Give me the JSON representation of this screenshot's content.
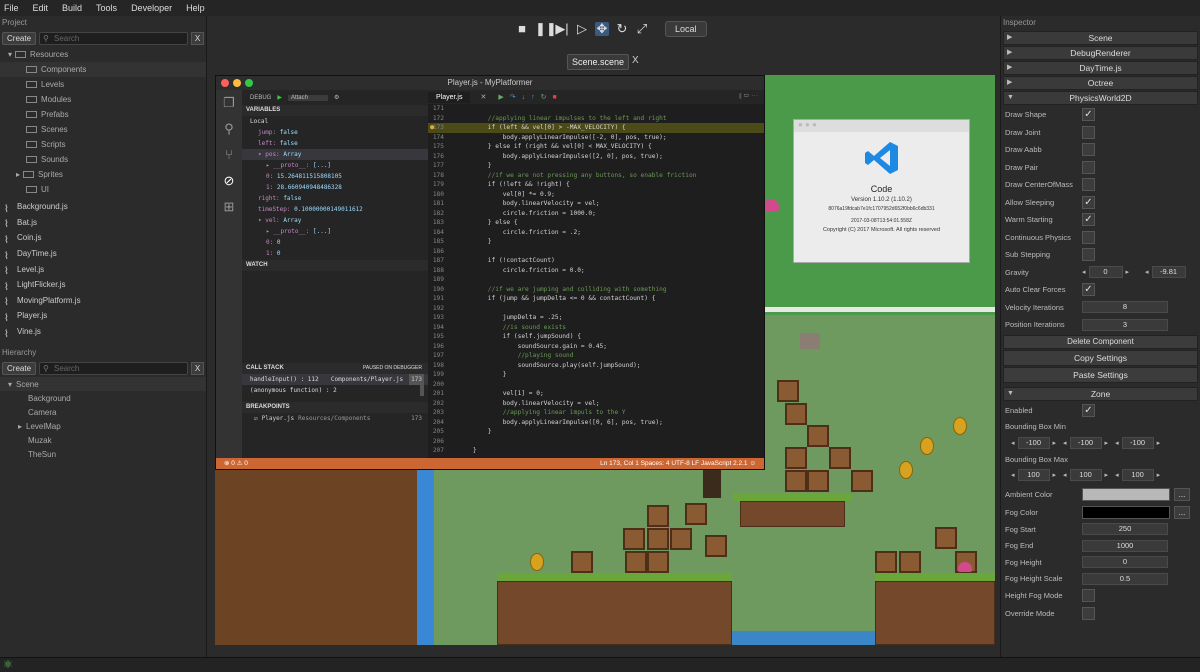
{
  "menu": [
    "File",
    "Edit",
    "Build",
    "Tools",
    "Developer",
    "Help"
  ],
  "toolbar": {
    "local_label": "Local"
  },
  "project": {
    "title": "Project",
    "create": "Create",
    "search_placeholder": "Search",
    "close": "X",
    "folders": [
      "Resources",
      "Components",
      "Levels",
      "Modules",
      "Prefabs",
      "Scenes",
      "Scripts",
      "Sounds",
      "Sprites",
      "UI"
    ],
    "scripts": [
      "Background.js",
      "Bat.js",
      "Coin.js",
      "DayTime.js",
      "Level.js",
      "LightFlicker.js",
      "MovingPlatform.js",
      "Player.js",
      "Vine.js"
    ]
  },
  "hierarchy": {
    "title": "Hierarchy",
    "create": "Create",
    "search_placeholder": "Search",
    "close": "X",
    "items": [
      "Scene",
      "Background",
      "Camera",
      "LevelMap",
      "Muzak",
      "TheSun"
    ]
  },
  "scene_tab": {
    "label": "Scene.scene",
    "close": "X"
  },
  "vscode": {
    "title": "Player.js - MyPlatformer",
    "debug_label": "DEBUG",
    "attach": "Attach",
    "variables": "VARIABLES",
    "local": "Local",
    "vars": [
      {
        "k": "jump:",
        "v": "false",
        "ind": 0
      },
      {
        "k": "left:",
        "v": "false",
        "ind": 0
      },
      {
        "k": "▾ pos:",
        "v": "Array",
        "ind": 0
      },
      {
        "k": "▸ __proto__:",
        "v": "[...]",
        "ind": 1
      },
      {
        "k": "0:",
        "v": "15.264811515808105",
        "ind": 1
      },
      {
        "k": "1:",
        "v": "28.660940948486328",
        "ind": 1
      },
      {
        "k": "right:",
        "v": "false",
        "ind": 0
      },
      {
        "k": "timeStep:",
        "v": "0.10000000149011612",
        "ind": 0
      },
      {
        "k": "▾ vel:",
        "v": "Array",
        "ind": 0
      },
      {
        "k": "▸ __proto__:",
        "v": "[...]",
        "ind": 1
      },
      {
        "k": "0:",
        "v": "0",
        "ind": 1
      },
      {
        "k": "1:",
        "v": "0",
        "ind": 1
      }
    ],
    "watch": "WATCH",
    "callstack": "CALL STACK",
    "paused": "PAUSED ON DEBUGGER",
    "stack": [
      {
        "fn": "handleInput() : 112",
        "file": "Components/Player.js",
        "ln": "173"
      },
      {
        "fn": "(anonymous function) : 2",
        "file": "",
        "ln": ""
      }
    ],
    "breakpoints": "BREAKPOINTS",
    "bp_file": "Player.js",
    "bp_path": "Resources/Components",
    "bp_line": "173",
    "tab": "Player.js",
    "code": [
      {
        "n": "171",
        "t": ""
      },
      {
        "n": "172",
        "t": "        //applying linear impulses to the left and right"
      },
      {
        "n": "173",
        "t": "        if (left && vel[0] > -MAX_VELOCITY) {"
      },
      {
        "n": "174",
        "t": "            body.applyLinearImpulse([-2, 0], pos, true);"
      },
      {
        "n": "175",
        "t": "        } else if (right && vel[0] < MAX_VELOCITY) {"
      },
      {
        "n": "176",
        "t": "            body.applyLinearImpulse([2, 0], pos, true);"
      },
      {
        "n": "177",
        "t": "        }"
      },
      {
        "n": "178",
        "t": "        //if we are not pressing any buttons, so enable friction"
      },
      {
        "n": "179",
        "t": "        if (!left && !right) {"
      },
      {
        "n": "180",
        "t": "            vel[0] *= 0.9;"
      },
      {
        "n": "181",
        "t": "            body.linearVelocity = vel;"
      },
      {
        "n": "182",
        "t": "            circle.friction = 1000.0;"
      },
      {
        "n": "183",
        "t": "        } else {"
      },
      {
        "n": "184",
        "t": "            circle.friction = .2;"
      },
      {
        "n": "185",
        "t": "        }"
      },
      {
        "n": "186",
        "t": ""
      },
      {
        "n": "187",
        "t": "        if (!contactCount)"
      },
      {
        "n": "188",
        "t": "            circle.friction = 0.0;"
      },
      {
        "n": "189",
        "t": ""
      },
      {
        "n": "190",
        "t": "        //if we are jumping and colliding with something"
      },
      {
        "n": "191",
        "t": "        if (jump && jumpDelta <= 0 && contactCount) {"
      },
      {
        "n": "192",
        "t": ""
      },
      {
        "n": "193",
        "t": "            jumpDelta = .25;"
      },
      {
        "n": "194",
        "t": "            //is sound exists"
      },
      {
        "n": "195",
        "t": "            if (self.jumpSound) {"
      },
      {
        "n": "196",
        "t": "                soundSource.gain = 0.45;"
      },
      {
        "n": "197",
        "t": "                //playing sound"
      },
      {
        "n": "198",
        "t": "                soundSource.play(self.jumpSound);"
      },
      {
        "n": "199",
        "t": "            }"
      },
      {
        "n": "200",
        "t": ""
      },
      {
        "n": "201",
        "t": "            vel[1] = 0;"
      },
      {
        "n": "202",
        "t": "            body.linearVelocity = vel;"
      },
      {
        "n": "203",
        "t": "            //applying linear impuls to the Y"
      },
      {
        "n": "204",
        "t": "            body.applyLinearImpulse([0, 6], pos, true);"
      },
      {
        "n": "205",
        "t": "        }"
      },
      {
        "n": "206",
        "t": ""
      },
      {
        "n": "207",
        "t": "    }"
      }
    ],
    "status_left": "⊗ 0  ⚠ 0",
    "status_right": "Ln 173, Col 1    Spaces: 4    UTF-8    LF    JavaScript    2.2.1    ☺"
  },
  "about": {
    "name": "Code",
    "version": "Version 1.10.2 (1.10.2)",
    "hash": "8076a19fdcab7e1fc1707952d652f0bb6c6db331",
    "date": "2017-03-08T13:54:01.558Z",
    "copyright": "Copyright (C) 2017 Microsoft. All rights reserved"
  },
  "inspector": {
    "title": "Inspector",
    "sections": [
      "Scene",
      "DebugRenderer",
      "DayTime.js",
      "Octree",
      "PhysicsWorld2D"
    ],
    "physics": [
      {
        "l": "Draw Shape",
        "c": true
      },
      {
        "l": "Draw Joint",
        "c": false
      },
      {
        "l": "Draw Aabb",
        "c": false
      },
      {
        "l": "Draw Pair",
        "c": false
      },
      {
        "l": "Draw CenterOfMass",
        "c": false
      },
      {
        "l": "Allow Sleeping",
        "c": true
      },
      {
        "l": "Warm Starting",
        "c": true
      },
      {
        "l": "Continuous Physics",
        "c": false
      },
      {
        "l": "Sub Stepping",
        "c": false
      }
    ],
    "gravity_label": "Gravity",
    "gravity_x": "0",
    "gravity_y": "-9.81",
    "auto_clear": "Auto Clear Forces",
    "vel_iter_label": "Velocity Iterations",
    "vel_iter": "8",
    "pos_iter_label": "Position Iterations",
    "pos_iter": "3",
    "delete": "Delete Component",
    "copy": "Copy Settings",
    "paste": "Paste Settings",
    "zone": "Zone",
    "enabled": "Enabled",
    "bbmin_label": "Bounding Box Min",
    "bbmin": [
      "-100",
      "-100",
      "-100"
    ],
    "bbmax_label": "Bounding Box Max",
    "bbmax": [
      "100",
      "100",
      "100"
    ],
    "ambient": "Ambient Color",
    "fogcolor": "Fog Color",
    "ellipsis": "...",
    "fog": [
      {
        "l": "Fog Start",
        "v": "250"
      },
      {
        "l": "Fog End",
        "v": "1000"
      },
      {
        "l": "Fog Height",
        "v": "0"
      },
      {
        "l": "Fog Height Scale",
        "v": "0.5"
      }
    ],
    "height_fog": "Height Fog Mode",
    "override": "Override Mode"
  }
}
